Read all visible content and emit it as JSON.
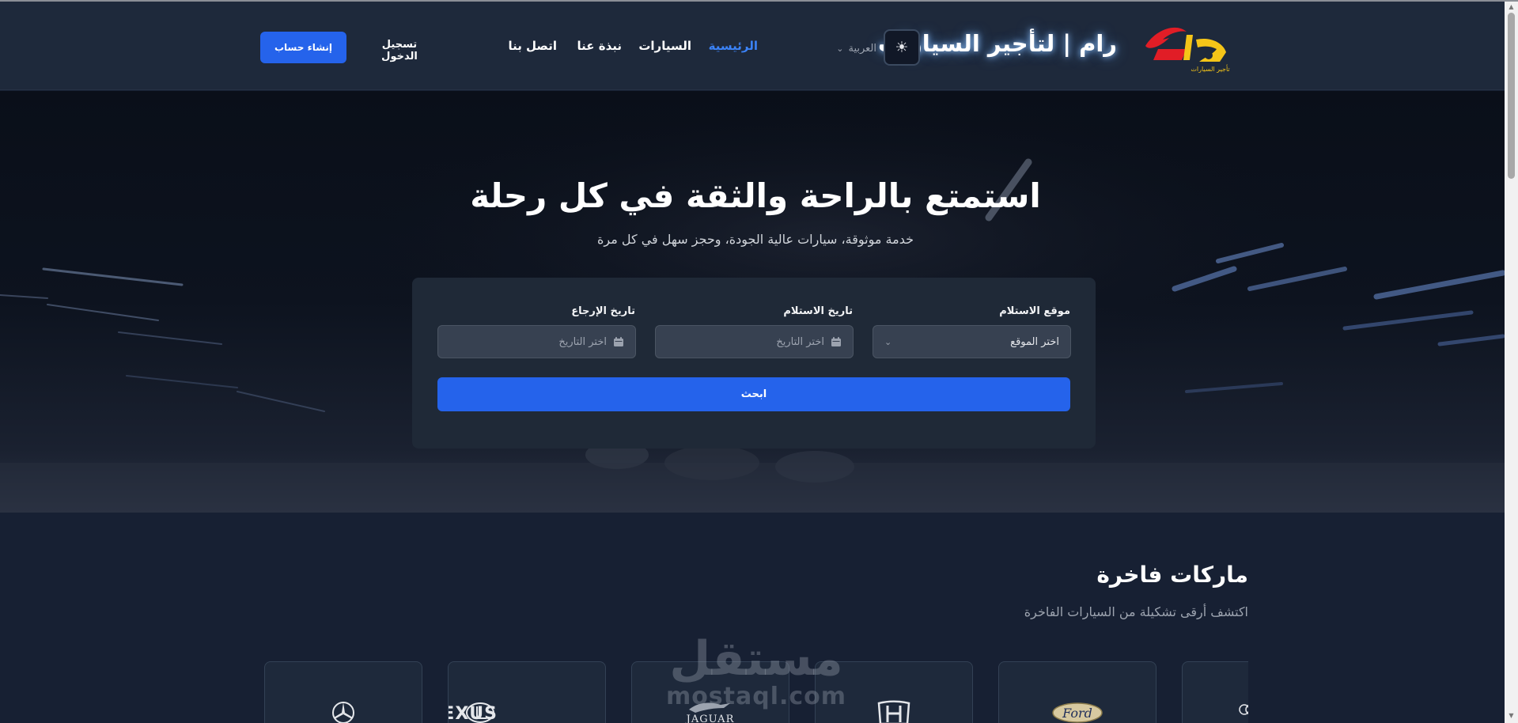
{
  "header": {
    "site_name": "رام | لتأجير السيارات",
    "logo_text": "رام",
    "logo_tagline": "تأجير السيارات",
    "theme_toggle_icon": "sun-icon",
    "language": "العربية",
    "nav": [
      {
        "label": "الرئيسية",
        "active": true
      },
      {
        "label": "السيارات",
        "active": false
      },
      {
        "label": "نبذة عنا",
        "active": false
      },
      {
        "label": "اتصل بنا",
        "active": false
      }
    ],
    "login_label": "تسجيل الدخول",
    "register_label": "إنشاء حساب"
  },
  "hero": {
    "title": "استمتع بالراحة والثقة في كل رحلة",
    "subtitle": "خدمة موثوقة، سيارات عالية الجودة، وحجز سهل في كل مرة"
  },
  "search": {
    "location_label": "موقع الاستلام",
    "location_value": "اختر الموقع",
    "pickup_label": "تاريخ الاستلام",
    "pickup_placeholder": "اختر التاريخ",
    "return_label": "تاريخ الإرجاع",
    "return_placeholder": "اختر التاريخ",
    "button_label": "ابحث"
  },
  "brands": {
    "title": "ماركات فاخرة",
    "subtitle": "اكتشف أرقى تشكيلة من السيارات الفاخرة",
    "items": [
      {
        "name": "Mercedes-Benz",
        "icon": "mercedes-logo"
      },
      {
        "name": "LEXUS",
        "icon": "lexus-logo"
      },
      {
        "name": "JAGUAR",
        "icon": "jaguar-logo"
      },
      {
        "name": "Honda",
        "icon": "honda-logo"
      },
      {
        "name": "Ford",
        "icon": "ford-logo"
      },
      {
        "name": "Audi",
        "icon": "audi-logo"
      }
    ]
  },
  "watermark": {
    "arabic": "مستقل",
    "latin": "mostaql.com"
  },
  "colors": {
    "accent": "#2563eb",
    "nav_active": "#3b82f6",
    "header_bg": "#1e293b",
    "page_bg": "#172033",
    "card_bg": "#1f2937",
    "logo_red": "#e11d26",
    "logo_yellow": "#f5c518"
  }
}
